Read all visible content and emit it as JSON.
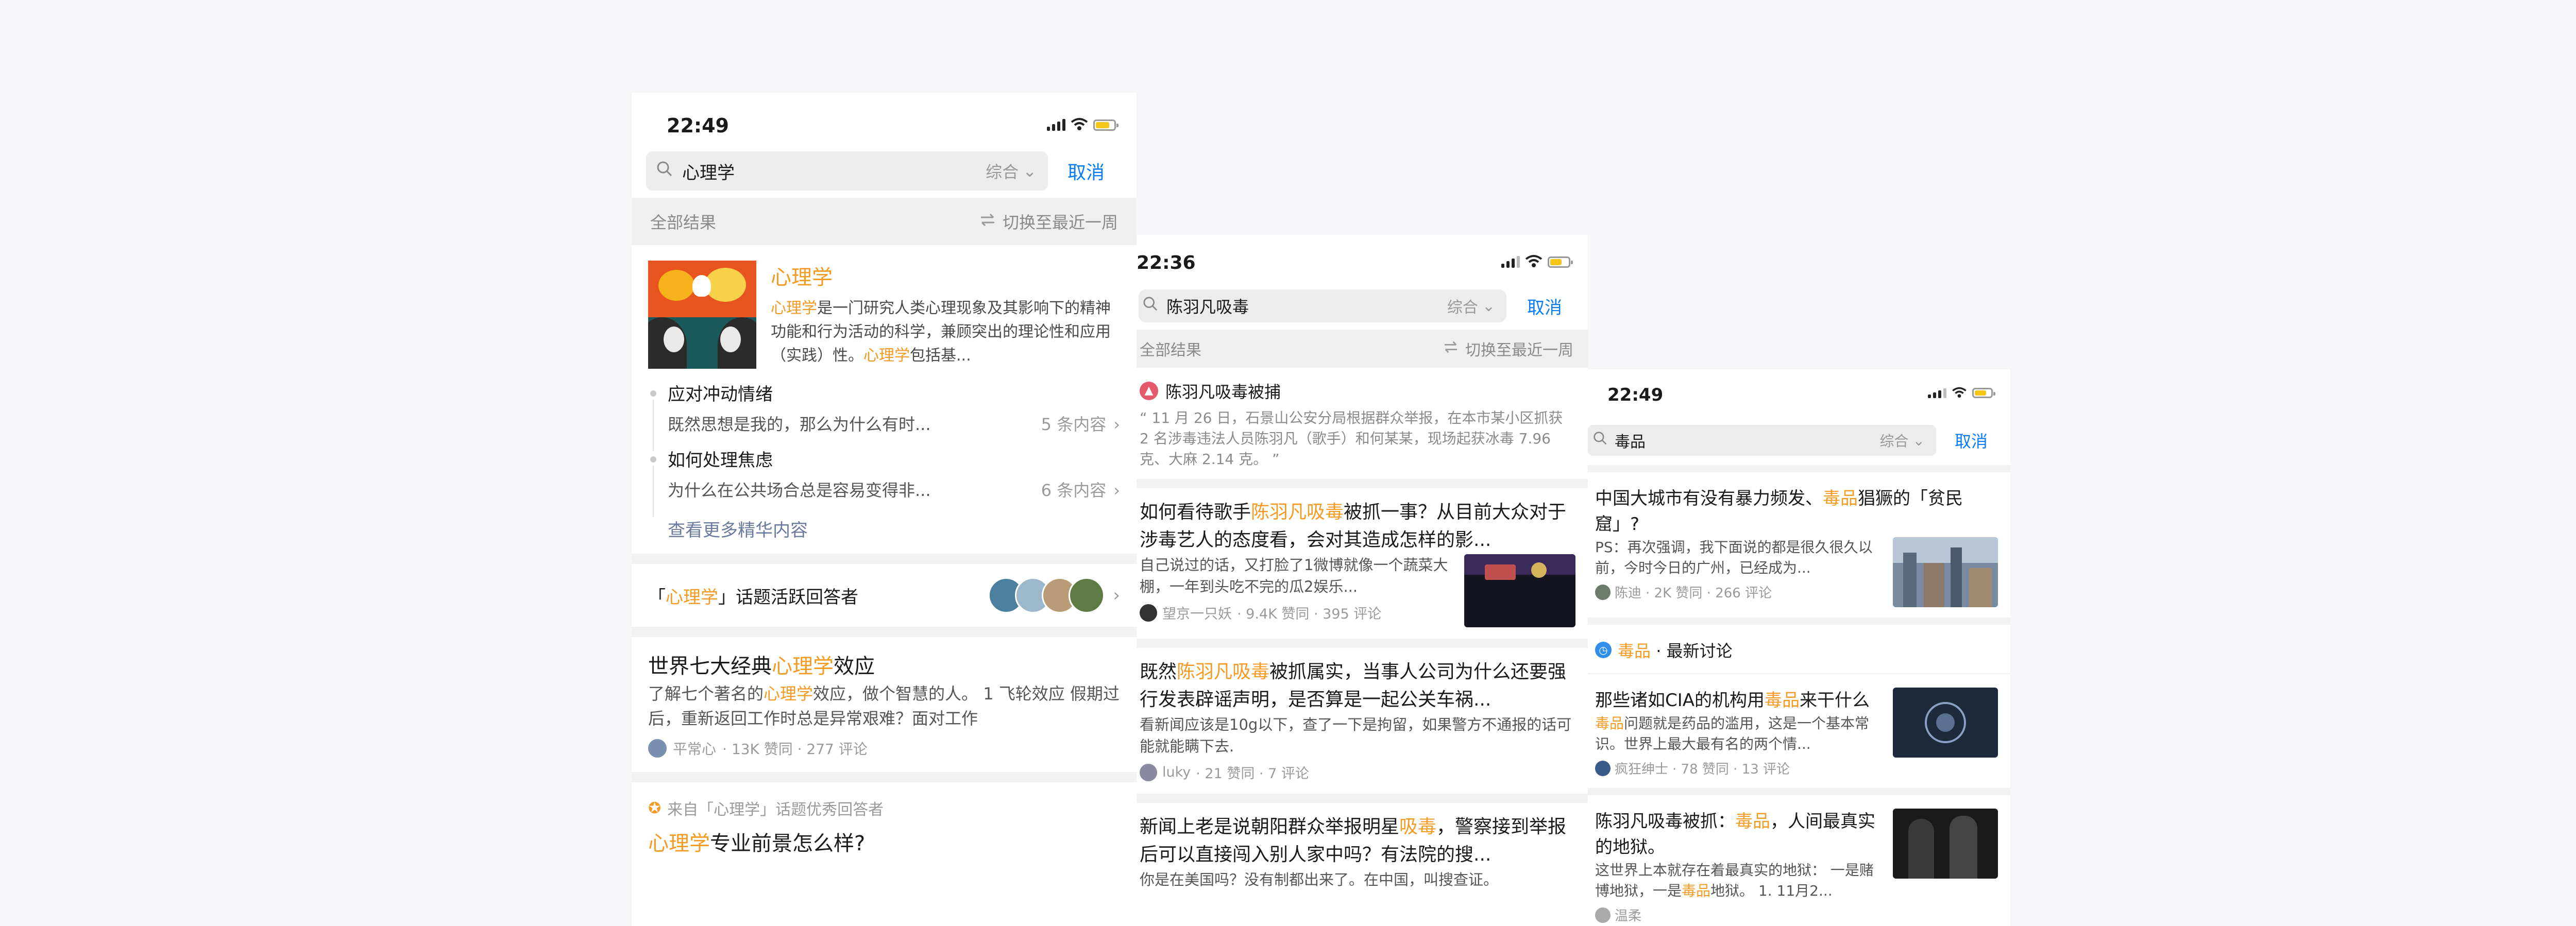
{
  "phone1": {
    "time": "22:49",
    "search": {
      "query": "心理学",
      "filter": "综合",
      "cancel": "取消"
    },
    "results_label": "全部结果",
    "switch_label": "切换至最近一周",
    "topic": {
      "title": "心理学",
      "desc_hl1": "心理学",
      "desc_mid": "是一门研究人类心理现象及其影响下的精神功能和行为活动的科学，兼顾突出的理论性和应用（实践）性。",
      "desc_hl2": "心理学",
      "desc_tail": "包括基..."
    },
    "subtopics": [
      {
        "title": "应对冲动情绪",
        "snippet": "既然思想是我的，那么为什么有时...",
        "count": "5 条内容"
      },
      {
        "title": "如何处理焦虑",
        "snippet": "为什么在公共场合总是容易变得非...",
        "count": "6 条内容"
      }
    ],
    "more_label": "查看更多精华内容",
    "active": {
      "pre": "「",
      "hl": "心理学",
      "post": "」话题活跃回答者"
    },
    "card1": {
      "title_pre": "世界七大经典",
      "title_hl": "心理学",
      "title_post": "效应",
      "body_pre": "了解七个著名的",
      "body_hl": "心理学",
      "body_post": "效应，做个智慧的人。 1 飞轮效应 假期过后，重新返回工作时总是异常艰难？面对工作",
      "author": "平常心",
      "stats": "· 13K 赞同 · 277 评论"
    },
    "card2": {
      "from_pre": "来自「",
      "from_topic": "心理学",
      "from_post": "」话题优秀回答者",
      "title_hl": "心理学",
      "title_post": "专业前景怎么样?"
    }
  },
  "phone2": {
    "time": "22:36",
    "search": {
      "query": "陈羽凡吸毒",
      "filter": "综合",
      "cancel": "取消"
    },
    "results_label": "全部结果",
    "switch_label": "切换至最近一周",
    "news": {
      "title": "陈羽凡吸毒被捕",
      "quote": "11 月 26 日，石景山公安分局根据群众举报，在本市某小区抓获 2 名涉毒违法人员陈羽凡（歌手）和何某某，现场起获冰毒 7.96 克、大麻 2.14 克。"
    },
    "cards": [
      {
        "title_pre": "如何看待歌手",
        "title_hl": "陈羽凡吸毒",
        "title_post": "被抓一事？从目前大众对于涉毒艺人的态度看，会对其造成怎样的影...",
        "body": "自己说过的话，又打脸了1微博就像一个蔬菜大棚，一年到头吃不完的瓜2娱乐...",
        "author": "望京一只妖",
        "stats": "· 9.4K 赞同 · 395 评论"
      },
      {
        "title_pre": "既然",
        "title_hl": "陈羽凡吸毒",
        "title_post": "被抓属实，当事人公司为什么还要强行发表辟谣声明，是否算是一起公关车祸...",
        "body": "看新闻应该是10g以下，查了一下是拘留，如果警方不通报的话可能就能瞒下去.",
        "author": "luky",
        "stats": "· 21 赞同 · 7 评论"
      },
      {
        "title_pre": "新闻上老是说朝阳群众举报明星",
        "title_hl": "吸毒",
        "title_post": "，警察接到举报后可以直接闯入别人家中吗？有法院的搜...",
        "body": "你是在美国吗？没有制都出来了。在中国，叫搜查证。"
      }
    ]
  },
  "phone3": {
    "time": "22:49",
    "search": {
      "query": "毒品",
      "filter": "综合",
      "cancel": "取消"
    },
    "card1": {
      "title_pre": "中国大城市有没有暴力频发、",
      "title_hl": "毒品",
      "title_post": "猖獗的「贫民窟」?",
      "body": "PS：再次强调，我下面说的都是很久很久以前，今时今日的广州，已经成为...",
      "author": "陈迪",
      "stats": "· 2K 赞同 · 266 评论"
    },
    "section": {
      "hl": "毒品",
      "label": "· 最新讨论"
    },
    "card2": {
      "title_pre": "那些诸如CIA的机构用",
      "title_hl": "毒品",
      "title_post": "来干什么",
      "body_hl": "毒品",
      "body_post": "问题就是药品的滥用，这是一个基本常识。世界上最大最有名的两个情...",
      "author": "疯狂绅士",
      "stats": "· 78 赞同 · 13 评论"
    },
    "card3": {
      "title_pre": "陈羽凡吸毒被抓：",
      "title_hl": "毒品",
      "title_post": "，人间最真实的地狱。",
      "body_pre": "这世界上本就存在着最真实的地狱： 一是赌博地狱，一是",
      "body_hl": "毒品",
      "body_post": "地狱。 1. 11月2...",
      "author": "温柔"
    }
  },
  "colors": {
    "highlight": "#f59a23",
    "link": "#0a7cf5"
  }
}
